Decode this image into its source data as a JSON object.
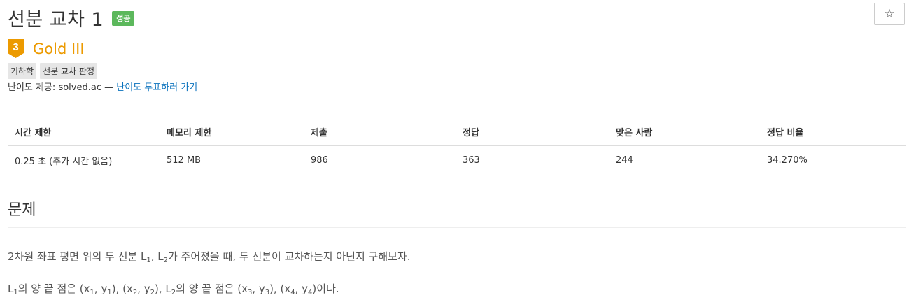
{
  "header": {
    "title": "선분 교차 1",
    "status_badge": "성공",
    "star_icon": "star-outline-icon",
    "star_glyph": "☆"
  },
  "tier": {
    "level": "3",
    "label": "Gold III",
    "color": "#ec9a00"
  },
  "tags": [
    "기하학",
    "선분 교차 판정"
  ],
  "provider": {
    "prefix": "난이도 제공: solved.ac —",
    "link_text": "난이도 투표하러 가기"
  },
  "stats": {
    "headers": [
      "시간 제한",
      "메모리 제한",
      "제출",
      "정답",
      "맞은 사람",
      "정답 비율"
    ],
    "values": [
      "0.25 초 (추가 시간 없음)",
      "512 MB",
      "986",
      "363",
      "244",
      "34.270%"
    ]
  },
  "section": {
    "title": "문제"
  },
  "problem": {
    "p1": {
      "a": "2차원 좌표 평면 위의 두 선분 L",
      "a_sub": "1",
      "b": ", L",
      "b_sub": "2",
      "c": "가 주어졌을 때, 두 선분이 교차하는지 아닌지 구해보자."
    },
    "p2": {
      "t0": "L",
      "s0": "1",
      "t1": "의 양 끝 점은 (x",
      "s1": "1",
      "t2": ", y",
      "s2": "1",
      "t3": "), (x",
      "s3": "2",
      "t4": ", y",
      "s4": "2",
      "t5": "), L",
      "s5": "2",
      "t6": "의 양 끝 점은 (x",
      "s6": "3",
      "t7": ", y",
      "s7": "3",
      "t8": "), (x",
      "s8": "4",
      "t9": ", y",
      "s9": "4",
      "t10": ")이다."
    }
  },
  "colors": {
    "success": "#5cb85c",
    "gold": "#ec9a00",
    "link": "#0a72bd"
  }
}
